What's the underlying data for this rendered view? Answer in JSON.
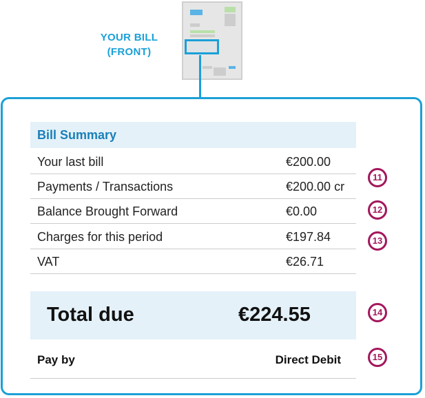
{
  "thumbnail": {
    "caption_line1": "YOUR BILL",
    "caption_line2": "(FRONT)"
  },
  "summary": {
    "heading": "Bill Summary",
    "rows": [
      {
        "label": "Your last bill",
        "amount": "€200.00"
      },
      {
        "label": "Payments / Transactions",
        "amount": "€200.00 cr"
      },
      {
        "label": "Balance Brought Forward",
        "amount": "€0.00"
      },
      {
        "label": "Charges for this period",
        "amount": "€197.84"
      },
      {
        "label": "VAT",
        "amount": "€26.71"
      }
    ],
    "total_label": "Total due",
    "total_amount": "€224.55",
    "payby_label": "Pay by",
    "payby_value": "Direct Debit"
  },
  "markers": [
    "11",
    "12",
    "13",
    "14",
    "15"
  ],
  "colors": {
    "accent_blue": "#1aa0d8",
    "marker_magenta": "#a3175c",
    "header_fill": "#e4f1f9"
  }
}
